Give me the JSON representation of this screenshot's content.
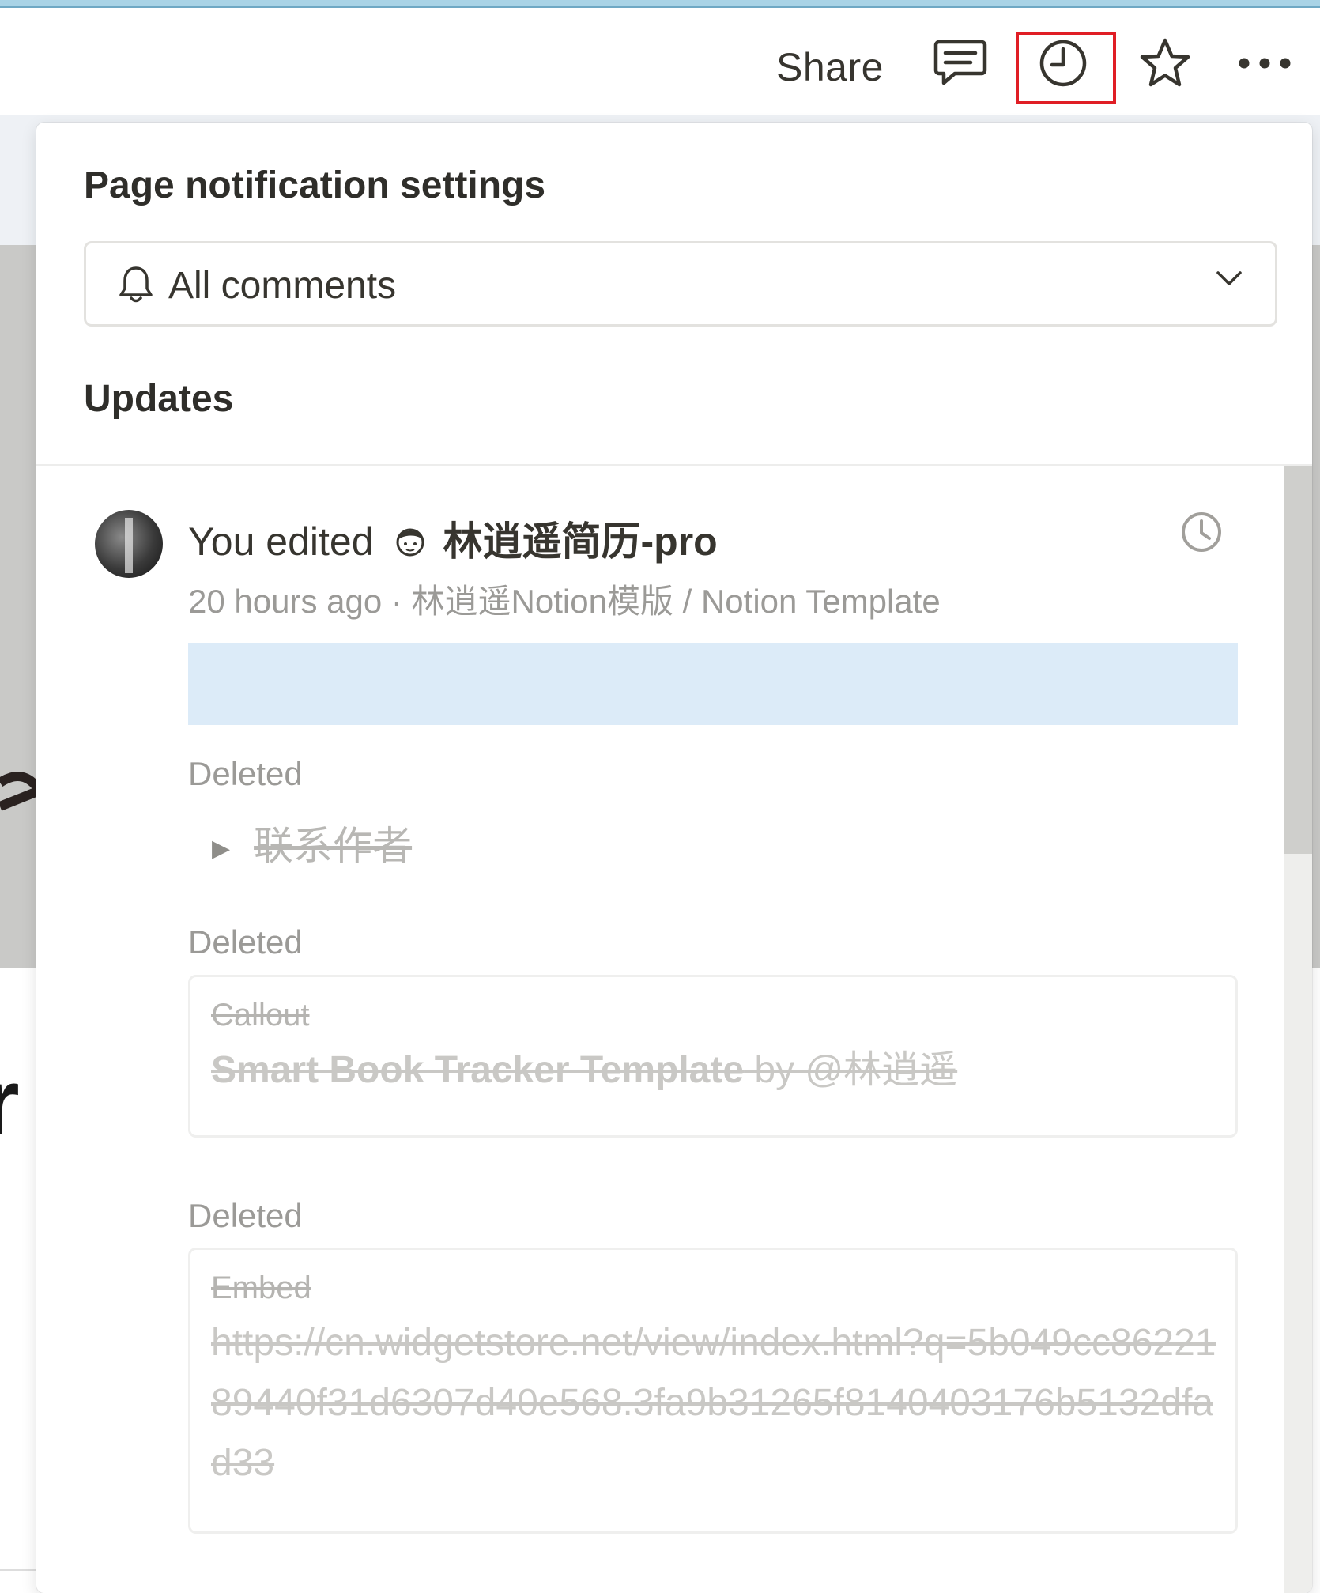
{
  "topbar": {
    "share_label": "Share"
  },
  "popover": {
    "title": "Page notification settings",
    "select_value": "All comments",
    "updates_heading": "Updates"
  },
  "update": {
    "action": "You edited",
    "page_name": "林逍遥简历-pro",
    "time": "20 hours ago",
    "separator": "·",
    "location": "林逍遥Notion模版 / Notion Template",
    "changes": [
      {
        "label": "Deleted",
        "text": "联系作者"
      },
      {
        "label": "Deleted",
        "kind": "Callout",
        "text_bold": "Smart Book Tracker Template",
        "text_rest": " by @林逍遥"
      },
      {
        "label": "Deleted",
        "kind": "Embed",
        "text": "https://cn.widgetstore.net/view/index.html?q=5b049cc8622189440f31d6307d40e568.3fa9b31265f8140403176b5132dfad33"
      }
    ]
  },
  "colors": {
    "accent_highlight": "#e01e25",
    "edit_highlight": "#dcebf8",
    "muted_text": "#9b9a97"
  }
}
